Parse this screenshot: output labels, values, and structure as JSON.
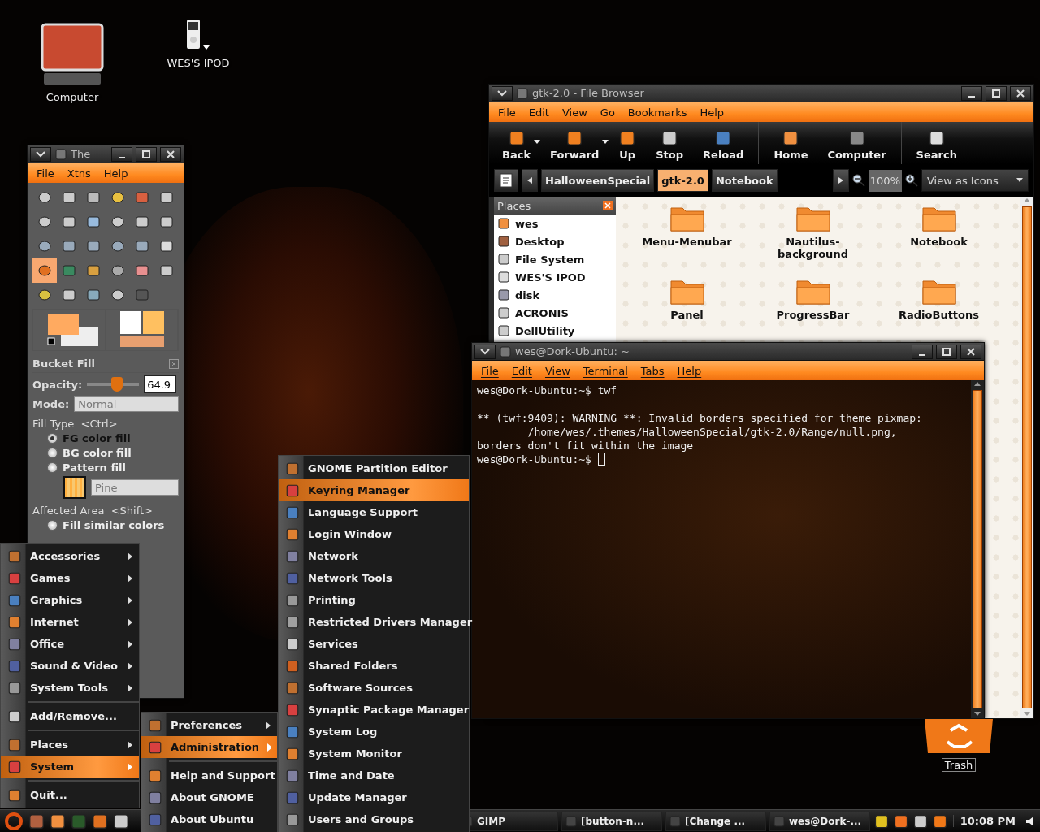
{
  "desktop_icons": [
    {
      "label": "Computer"
    },
    {
      "label": "WES'S IPOD"
    }
  ],
  "gimp": {
    "title": "The",
    "menu": [
      "File",
      "Xtns",
      "Help"
    ],
    "tools": [
      {
        "selected": false
      },
      {
        "selected": false
      },
      {
        "selected": false
      },
      {
        "selected": false
      },
      {
        "selected": false
      },
      {
        "selected": false
      },
      {
        "selected": false
      },
      {
        "selected": false
      },
      {
        "selected": false
      },
      {
        "selected": false
      },
      {
        "selected": false
      },
      {
        "selected": false
      },
      {
        "selected": false
      },
      {
        "selected": false
      },
      {
        "selected": false
      },
      {
        "selected": false
      },
      {
        "selected": false
      },
      {
        "selected": false
      },
      {
        "selected": true
      },
      {
        "selected": false
      },
      {
        "selected": false
      },
      {
        "selected": false
      },
      {
        "selected": false
      },
      {
        "selected": false
      },
      {
        "selected": false
      },
      {
        "selected": false
      },
      {
        "selected": false
      },
      {
        "selected": false
      },
      {
        "selected": false
      }
    ],
    "panel_title": "Bucket Fill",
    "opacity": {
      "label": "Opacity:",
      "level": 0.6,
      "value": "64.9"
    },
    "mode": {
      "label": "Mode:",
      "value": "Normal",
      "disabled": true
    },
    "fill_type": {
      "label": "Fill Type  <Ctrl>",
      "options": [
        {
          "label": "FG color fill",
          "selected": true
        },
        {
          "label": "BG color fill",
          "selected": false
        },
        {
          "label": "Pattern fill",
          "selected": false
        }
      ]
    },
    "pattern": {
      "name": "Pine"
    },
    "affected_area": {
      "label": "Affected Area  <Shift>",
      "options": [
        {
          "label": "Fill similar colors",
          "selected": false
        }
      ]
    }
  },
  "file_browser": {
    "title": "gtk-2.0 - File Browser",
    "menu": [
      "File",
      "Edit",
      "View",
      "Go",
      "Bookmarks",
      "Help"
    ],
    "toolbar": [
      [
        {
          "label": "Back",
          "dropdown": true
        },
        {
          "label": "Forward",
          "dropdown": true
        },
        {
          "label": "Up",
          "dropdown": false
        },
        {
          "label": "Stop",
          "dropdown": false
        },
        {
          "label": "Reload",
          "dropdown": false
        }
      ],
      [
        {
          "label": "Home",
          "dropdown": false
        },
        {
          "label": "Computer",
          "dropdown": false
        }
      ],
      [
        {
          "label": "Search",
          "dropdown": false
        }
      ]
    ],
    "path": [
      {
        "label": "HalloweenSpecial",
        "selected": false
      },
      {
        "label": "gtk-2.0",
        "selected": true
      },
      {
        "label": "Notebook",
        "selected": false
      }
    ],
    "zoom": "100%",
    "view": "View as Icons",
    "places": {
      "title": "Places",
      "items": [
        "wes",
        "Desktop",
        "File System",
        "WES'S IPOD",
        "disk",
        "ACRONIS",
        "DellUtility"
      ]
    },
    "files": [
      "Menu-Menubar",
      "Nautilus-\nbackground",
      "Notebook",
      "Panel",
      "ProgressBar",
      "RadioButtons"
    ]
  },
  "terminal": {
    "title": "wes@Dork-Ubuntu: ~",
    "menu": [
      "File",
      "Edit",
      "View",
      "Terminal",
      "Tabs",
      "Help"
    ],
    "blocks": [
      [
        "wes@Dork-Ubuntu:~$ twf"
      ],
      [
        "** (twf:9409): WARNING **: Invalid borders specified for theme pixmap:",
        "        /home/wes/.themes/HalloweenSpecial/gtk-2.0/Range/null.png,",
        "borders don't fit within the image",
        "wes@Dork-Ubuntu:~$ "
      ]
    ]
  },
  "trash": {
    "label": "Trash"
  },
  "main_menu": [
    {
      "kind": "item",
      "label": "Accessories",
      "submenu": true,
      "selected": false
    },
    {
      "kind": "item",
      "label": "Games",
      "submenu": true,
      "selected": false
    },
    {
      "kind": "item",
      "label": "Graphics",
      "submenu": true,
      "selected": false
    },
    {
      "kind": "item",
      "label": "Internet",
      "submenu": true,
      "selected": false
    },
    {
      "kind": "item",
      "label": "Office",
      "submenu": true,
      "selected": false
    },
    {
      "kind": "item",
      "label": "Sound & Video",
      "submenu": true,
      "selected": false
    },
    {
      "kind": "item",
      "label": "System Tools",
      "submenu": true,
      "selected": false
    },
    {
      "kind": "separator"
    },
    {
      "kind": "item",
      "label": "Add/Remove...",
      "submenu": false,
      "selected": false
    },
    {
      "kind": "separator"
    },
    {
      "kind": "item",
      "label": "Places",
      "submenu": true,
      "selected": false
    },
    {
      "kind": "item",
      "label": "System",
      "submenu": true,
      "selected": true
    },
    {
      "kind": "separator"
    },
    {
      "kind": "item",
      "label": "Quit...",
      "submenu": false,
      "selected": false
    }
  ],
  "system_menu": [
    {
      "kind": "item",
      "label": "Preferences",
      "submenu": true,
      "selected": false
    },
    {
      "kind": "item",
      "label": "Administration",
      "submenu": true,
      "selected": true
    },
    {
      "kind": "separator"
    },
    {
      "kind": "item",
      "label": "Help and Support",
      "submenu": false,
      "selected": false
    },
    {
      "kind": "item",
      "label": "About GNOME",
      "submenu": false,
      "selected": false
    },
    {
      "kind": "item",
      "label": "About Ubuntu",
      "submenu": false,
      "selected": false
    }
  ],
  "admin_menu": [
    {
      "kind": "item",
      "label": "GNOME Partition Editor",
      "submenu": false,
      "selected": false
    },
    {
      "kind": "item",
      "label": "Keyring Manager",
      "submenu": false,
      "selected": true
    },
    {
      "kind": "item",
      "label": "Language Support",
      "submenu": false,
      "selected": false
    },
    {
      "kind": "item",
      "label": "Login Window",
      "submenu": false,
      "selected": false
    },
    {
      "kind": "item",
      "label": "Network",
      "submenu": false,
      "selected": false
    },
    {
      "kind": "item",
      "label": "Network Tools",
      "submenu": false,
      "selected": false
    },
    {
      "kind": "item",
      "label": "Printing",
      "submenu": false,
      "selected": false
    },
    {
      "kind": "item",
      "label": "Restricted Drivers Manager",
      "submenu": false,
      "selected": false
    },
    {
      "kind": "item",
      "label": "Services",
      "submenu": false,
      "selected": false
    },
    {
      "kind": "item",
      "label": "Shared Folders",
      "submenu": false,
      "selected": false
    },
    {
      "kind": "item",
      "label": "Software Sources",
      "submenu": false,
      "selected": false
    },
    {
      "kind": "item",
      "label": "Synaptic Package Manager",
      "submenu": false,
      "selected": false
    },
    {
      "kind": "item",
      "label": "System Log",
      "submenu": false,
      "selected": false
    },
    {
      "kind": "item",
      "label": "System Monitor",
      "submenu": false,
      "selected": false
    },
    {
      "kind": "item",
      "label": "Time and Date",
      "submenu": false,
      "selected": false
    },
    {
      "kind": "item",
      "label": "Update Manager",
      "submenu": false,
      "selected": false
    },
    {
      "kind": "item",
      "label": "Users and Groups",
      "submenu": false,
      "selected": false
    }
  ],
  "taskbar": {
    "tasks": [
      "GIMP",
      "[button-n...",
      "[Change ...",
      "wes@Dork-..."
    ],
    "clock": "10:08 PM"
  }
}
